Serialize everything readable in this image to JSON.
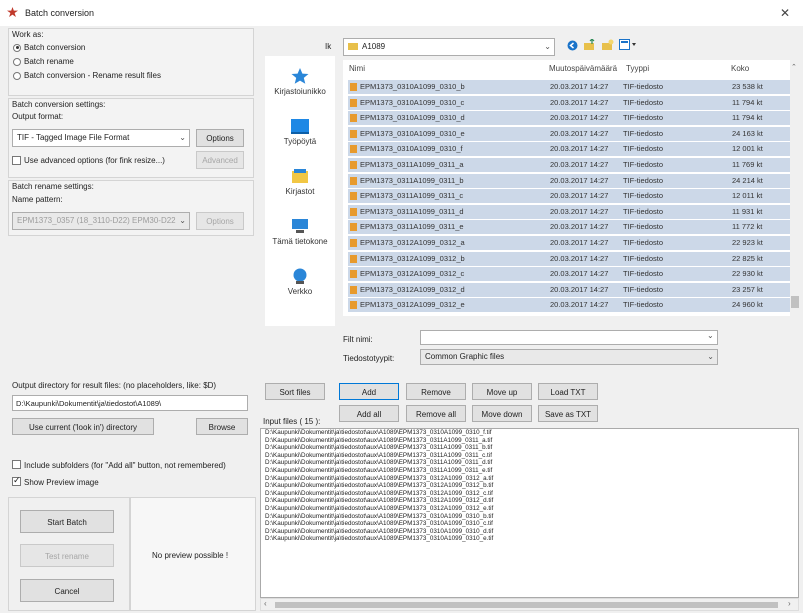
{
  "window": {
    "title": "Batch conversion",
    "close_glyph": "✕",
    "icon": "app-icon",
    "accent": "#0078d7"
  },
  "work_as": {
    "label": "Work as:",
    "options": [
      "Batch conversion",
      "Batch rename",
      "Batch conversion - Rename result files"
    ],
    "selected_index": 0
  },
  "conversion": {
    "label": "Batch conversion settings:",
    "output_format_label": "Output format:",
    "output_format_value": "TIF - Tagged Image File Format",
    "options_button": "Options",
    "advanced_checkbox_label": "Use advanced options (for fink resize...)",
    "advanced_checked": false,
    "advanced_button": "Advanced"
  },
  "rename": {
    "label": "Batch rename settings:",
    "name_pattern_label": "Name pattern:",
    "name_pattern_value": "EPM1373_0357 (18_3110-D22) EPM30-D22",
    "options_button": "Options"
  },
  "output": {
    "label": "Output directory for result files: (no placeholders, like: $D)",
    "dir_value": "D:\\Kaupunki\\Dokumentit\\ja\\tiedostot\\A1089\\",
    "use_current_button": "Use current ('look in') directory",
    "browse_button": "Browse"
  },
  "include_subfolders": {
    "label": "Include subfolders (for \"Add all\" button, not remembered)",
    "checked": false
  },
  "show_preview": {
    "label": "Show Preview image",
    "checked": true
  },
  "actions": {
    "start": "Start Batch",
    "test": "Test rename",
    "cancel": "Cancel"
  },
  "preview": {
    "text": "No preview possible !"
  },
  "browser": {
    "look_in_label": "Ik",
    "look_in_value": "A1089",
    "places": [
      "Kirjastoiunikko",
      "Työpöytä",
      "Kirjastot",
      "Tämä tietokone",
      "Verkko"
    ],
    "columns": [
      "Nimi",
      "Muutospäivämäärä",
      "Tyyppi",
      "Koko"
    ],
    "files": [
      {
        "name": "EPM1373_0310A1099_0310_b",
        "date": "20.03.2017 14:27",
        "type": "TIF-tiedosto",
        "size": "23 538 kt"
      },
      {
        "name": "EPM1373_0310A1099_0310_c",
        "date": "20.03.2017 14:27",
        "type": "TIF-tiedosto",
        "size": "11 794 kt"
      },
      {
        "name": "EPM1373_0310A1099_0310_d",
        "date": "20.03.2017 14:27",
        "type": "TIF-tiedosto",
        "size": "11 794 kt"
      },
      {
        "name": "EPM1373_0310A1099_0310_e",
        "date": "20.03.2017 14:27",
        "type": "TIF-tiedosto",
        "size": "24 163 kt"
      },
      {
        "name": "EPM1373_0310A1099_0310_f",
        "date": "20.03.2017 14:27",
        "type": "TIF-tiedosto",
        "size": "12 001 kt"
      },
      {
        "name": "EPM1373_0311A1099_0311_a",
        "date": "20.03.2017 14:27",
        "type": "TIF-tiedosto",
        "size": "11 769 kt"
      },
      {
        "name": "EPM1373_0311A1099_0311_b",
        "date": "20.03.2017 14:27",
        "type": "TIF-tiedosto",
        "size": "24 214 kt"
      },
      {
        "name": "EPM1373_0311A1099_0311_c",
        "date": "20.03.2017 14:27",
        "type": "TIF-tiedosto",
        "size": "12 011 kt"
      },
      {
        "name": "EPM1373_0311A1099_0311_d",
        "date": "20.03.2017 14:27",
        "type": "TIF-tiedosto",
        "size": "11 931 kt"
      },
      {
        "name": "EPM1373_0311A1099_0311_e",
        "date": "20.03.2017 14:27",
        "type": "TIF-tiedosto",
        "size": "11 772 kt"
      },
      {
        "name": "EPM1373_0312A1099_0312_a",
        "date": "20.03.2017 14:27",
        "type": "TIF-tiedosto",
        "size": "22 923 kt"
      },
      {
        "name": "EPM1373_0312A1099_0312_b",
        "date": "20.03.2017 14:27",
        "type": "TIF-tiedosto",
        "size": "22 825 kt"
      },
      {
        "name": "EPM1373_0312A1099_0312_c",
        "date": "20.03.2017 14:27",
        "type": "TIF-tiedosto",
        "size": "22 930 kt"
      },
      {
        "name": "EPM1373_0312A1099_0312_d",
        "date": "20.03.2017 14:27",
        "type": "TIF-tiedosto",
        "size": "23 257 kt"
      },
      {
        "name": "EPM1373_0312A1099_0312_e",
        "date": "20.03.2017 14:27",
        "type": "TIF-tiedosto",
        "size": "24 960 kt"
      }
    ],
    "filename_label": "Filt nimi:",
    "filename_value": "",
    "filetype_label": "Tiedostotyypit:",
    "filetype_value": "Common Graphic files"
  },
  "list_buttons": {
    "sort": "Sort files",
    "add": "Add",
    "remove": "Remove",
    "move_up": "Move up",
    "load_txt": "Load TXT",
    "add_all": "Add all",
    "remove_all": "Remove all",
    "move_down": "Move down",
    "save_txt": "Save as TXT"
  },
  "input_files": {
    "label": "Input files ( 15 ):",
    "items": [
      "D:\\Kaupunki\\Dokumentit\\ja\\tiedostot\\aux\\A1089\\EPM1373_0310A1099_0310_f.tif",
      "D:\\Kaupunki\\Dokumentit\\ja\\tiedostot\\aux\\A1089\\EPM1373_0311A1099_0311_a.tif",
      "D:\\Kaupunki\\Dokumentit\\ja\\tiedostot\\aux\\A1089\\EPM1373_0311A1099_0311_b.tif",
      "D:\\Kaupunki\\Dokumentit\\ja\\tiedostot\\aux\\A1089\\EPM1373_0311A1099_0311_c.tif",
      "D:\\Kaupunki\\Dokumentit\\ja\\tiedostot\\aux\\A1089\\EPM1373_0311A1099_0311_d.tif",
      "D:\\Kaupunki\\Dokumentit\\ja\\tiedostot\\aux\\A1089\\EPM1373_0311A1099_0311_e.tif",
      "D:\\Kaupunki\\Dokumentit\\ja\\tiedostot\\aux\\A1089\\EPM1373_0312A1099_0312_a.tif",
      "D:\\Kaupunki\\Dokumentit\\ja\\tiedostot\\aux\\A1089\\EPM1373_0312A1099_0312_b.tif",
      "D:\\Kaupunki\\Dokumentit\\ja\\tiedostot\\aux\\A1089\\EPM1373_0312A1099_0312_c.tif",
      "D:\\Kaupunki\\Dokumentit\\ja\\tiedostot\\aux\\A1089\\EPM1373_0312A1099_0312_d.tif",
      "D:\\Kaupunki\\Dokumentit\\ja\\tiedostot\\aux\\A1089\\EPM1373_0312A1099_0312_e.tif",
      "D:\\Kaupunki\\Dokumentit\\ja\\tiedostot\\aux\\A1089\\EPM1373_0310A1099_0310_b.tif",
      "D:\\Kaupunki\\Dokumentit\\ja\\tiedostot\\aux\\A1089\\EPM1373_0310A1099_0310_c.tif",
      "D:\\Kaupunki\\Dokumentit\\ja\\tiedostot\\aux\\A1089\\EPM1373_0310A1099_0310_d.tif",
      "D:\\Kaupunki\\Dokumentit\\ja\\tiedostot\\aux\\A1089\\EPM1373_0310A1099_0310_e.tif"
    ]
  }
}
